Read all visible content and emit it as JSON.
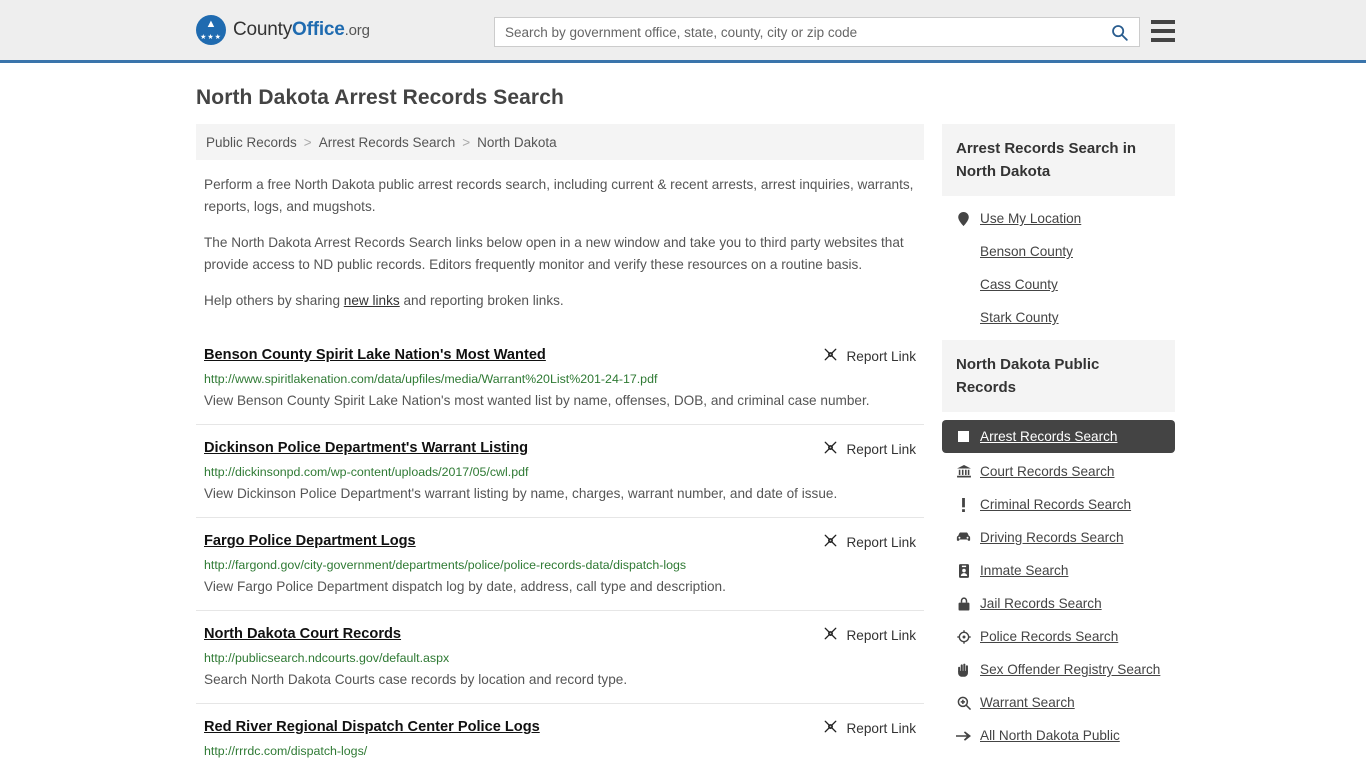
{
  "header": {
    "brand": {
      "part1": "County",
      "part2": "Office",
      "part3": ".org",
      "logo_icon": "eagle-stars-seal-icon"
    },
    "search": {
      "placeholder": "Search by government office, state, county, city or zip code",
      "value": "",
      "search_icon": "search-icon"
    },
    "menu_icon": "hamburger-menu-icon",
    "accent_color": "#3a74ab"
  },
  "page": {
    "title": "North Dakota Arrest Records Search"
  },
  "breadcrumb": {
    "items": [
      "Public Records",
      "Arrest Records Search",
      "North Dakota"
    ],
    "separator": ">"
  },
  "intro": {
    "p1": "Perform a free North Dakota public arrest records search, including current & recent arrests, arrest inquiries, warrants, reports, logs, and mugshots.",
    "p2": "The North Dakota Arrest Records Search links below open in a new window and take you to third party websites that provide access to ND public records. Editors frequently monitor and verify these resources on a routine basis.",
    "p3_before": "Help others by sharing ",
    "p3_link": "new links",
    "p3_after": " and reporting broken links."
  },
  "results": {
    "report_label": "Report Link",
    "report_icon": "broken-link-icon",
    "items": [
      {
        "title": "Benson County Spirit Lake Nation's Most Wanted",
        "url": "http://www.spiritlakenation.com/data/upfiles/media/Warrant%20List%201-24-17.pdf",
        "desc": "View Benson County Spirit Lake Nation's most wanted list by name, offenses, DOB, and criminal case number."
      },
      {
        "title": "Dickinson Police Department's Warrant Listing",
        "url": "http://dickinsonpd.com/wp-content/uploads/2017/05/cwl.pdf",
        "desc": "View Dickinson Police Department's warrant listing by name, charges, warrant number, and date of issue."
      },
      {
        "title": "Fargo Police Department Logs",
        "url": "http://fargond.gov/city-government/departments/police/police-records-data/dispatch-logs",
        "desc": "View Fargo Police Department dispatch log by date, address, call type and description."
      },
      {
        "title": "North Dakota Court Records",
        "url": "http://publicsearch.ndcourts.gov/default.aspx",
        "desc": "Search North Dakota Courts case records by location and record type."
      },
      {
        "title": "Red River Regional Dispatch Center Police Logs",
        "url": "http://rrrdc.com/dispatch-logs/",
        "desc": ""
      }
    ]
  },
  "sidebar": {
    "box1": {
      "heading": "Arrest Records Search in North Dakota",
      "links": [
        {
          "label": "Use My Location",
          "icon": "map-pin-icon"
        },
        {
          "label": "Benson County",
          "icon": ""
        },
        {
          "label": "Cass County",
          "icon": ""
        },
        {
          "label": "Stark County",
          "icon": ""
        }
      ]
    },
    "box2": {
      "heading": "North Dakota Public Records",
      "links": [
        {
          "label": "Arrest Records Search",
          "icon": "white-square-icon",
          "active": true
        },
        {
          "label": "Court Records Search",
          "icon": "courthouse-icon",
          "active": false
        },
        {
          "label": "Criminal Records Search",
          "icon": "exclamation-icon",
          "active": false
        },
        {
          "label": "Driving Records Search",
          "icon": "car-icon",
          "active": false
        },
        {
          "label": "Inmate Search",
          "icon": "id-badge-icon",
          "active": false
        },
        {
          "label": "Jail Records Search",
          "icon": "lock-icon",
          "active": false
        },
        {
          "label": "Police Records Search",
          "icon": "target-icon",
          "active": false
        },
        {
          "label": "Sex Offender Registry Search",
          "icon": "hand-icon",
          "active": false
        },
        {
          "label": "Warrant Search",
          "icon": "magnifier-plus-icon",
          "active": false
        },
        {
          "label": "All North Dakota Public",
          "icon": "arrow-right-icon",
          "active": false
        }
      ]
    }
  }
}
